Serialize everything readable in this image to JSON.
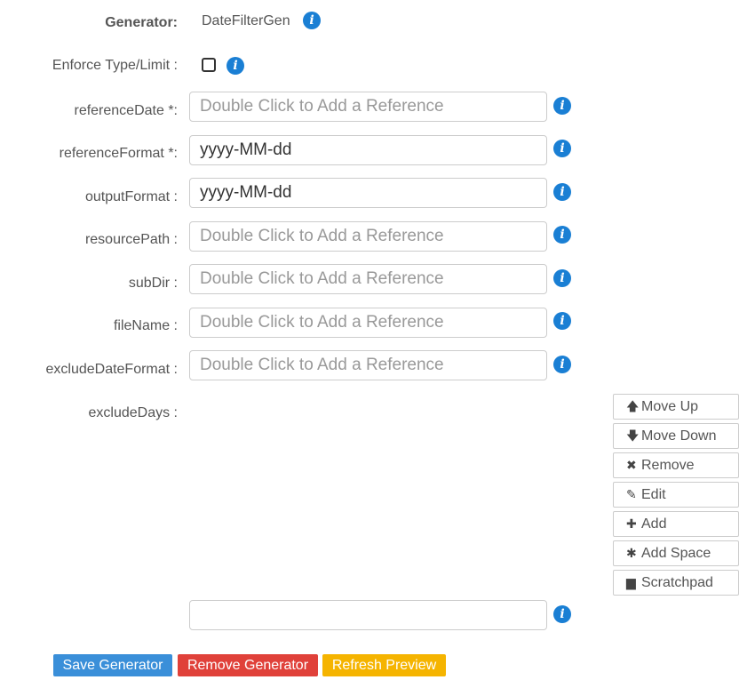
{
  "generator": {
    "label": "Generator:",
    "value": "DateFilterGen"
  },
  "enforce": {
    "label": "Enforce Type/Limit :",
    "checked": false
  },
  "fields": {
    "referenceDate": {
      "label": "referenceDate *:",
      "value": "",
      "placeholder": "Double Click to Add a Reference"
    },
    "referenceFormat": {
      "label": "referenceFormat *:",
      "value": "yyyy-MM-dd",
      "placeholder": ""
    },
    "outputFormat": {
      "label": "outputFormat :",
      "value": "yyyy-MM-dd",
      "placeholder": ""
    },
    "resourcePath": {
      "label": "resourcePath :",
      "value": "",
      "placeholder": "Double Click to Add a Reference"
    },
    "subDir": {
      "label": "subDir :",
      "value": "",
      "placeholder": "Double Click to Add a Reference"
    },
    "fileName": {
      "label": "fileName :",
      "value": "",
      "placeholder": "Double Click to Add a Reference"
    },
    "excludeDateFormat": {
      "label": "excludeDateFormat :",
      "value": "",
      "placeholder": "Double Click to Add a Reference"
    }
  },
  "excludeDays": {
    "label": "excludeDays :",
    "input_value": "",
    "buttons": [
      {
        "icon": "arrow-up-icon",
        "glyph": "🡅",
        "label": "Move Up"
      },
      {
        "icon": "arrow-down-icon",
        "glyph": "🡇",
        "label": "Move Down"
      },
      {
        "icon": "times-icon",
        "glyph": "✖",
        "label": "Remove"
      },
      {
        "icon": "pencil-icon",
        "glyph": "✎",
        "label": "Edit"
      },
      {
        "icon": "plus-icon",
        "glyph": "✚",
        "label": "Add"
      },
      {
        "icon": "asterisk-icon",
        "glyph": "✱",
        "label": "Add Space"
      },
      {
        "icon": "file-icon",
        "glyph": "▆",
        "label": "Scratchpad"
      }
    ]
  },
  "actions": {
    "save": {
      "label": "Save Generator",
      "color": "#3a8fd9"
    },
    "remove": {
      "label": "Remove Generator",
      "color": "#e0413a"
    },
    "refresh": {
      "label": "Refresh Preview",
      "color": "#f5b400"
    }
  },
  "colors": {
    "info": "#1a7fd4",
    "label": "#555555",
    "placeholder": "#999999"
  }
}
